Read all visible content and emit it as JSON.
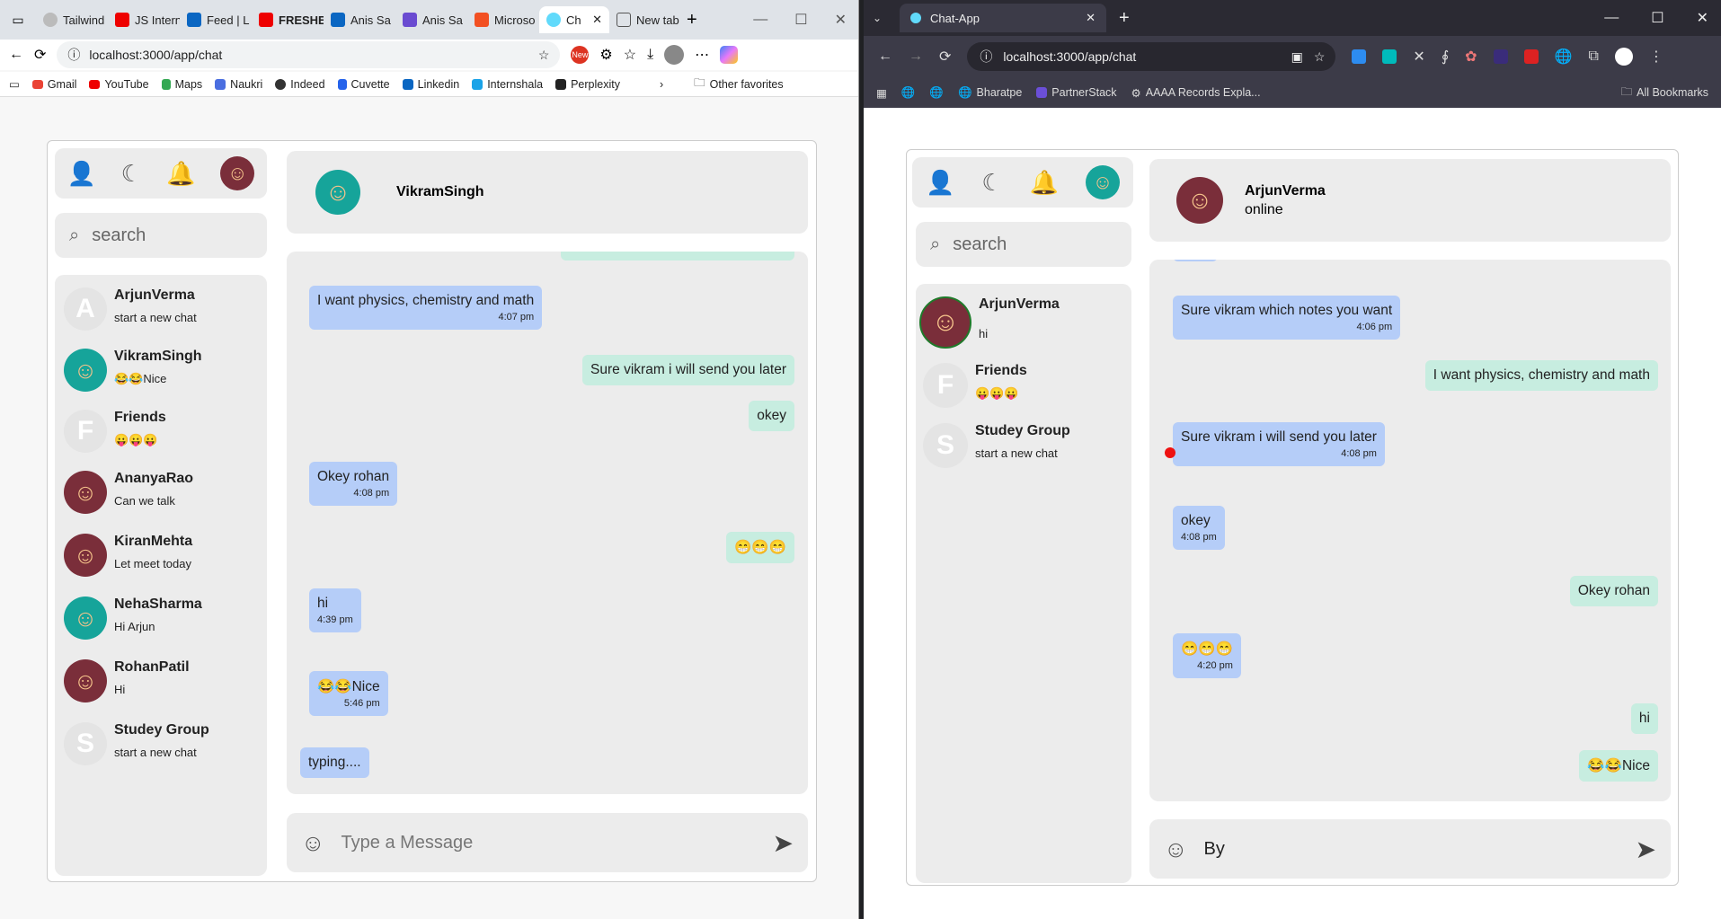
{
  "left": {
    "tabs": [
      "Tailwind",
      "JS Intern",
      "Feed | L",
      "FRESHE",
      "Anis Sa",
      "Anis Sa",
      "Microso",
      "Ch",
      "New tab"
    ],
    "url": "localhost:3000/app/chat",
    "bookmarks": [
      "Gmail",
      "YouTube",
      "Maps",
      "Naukri",
      "Indeed",
      "Cuvette",
      "Linkedin",
      "Internshala",
      "Perplexity"
    ],
    "other_favorites": "Other favorites",
    "new_badge": "New",
    "app": {
      "search_placeholder": "search",
      "header_name": "VikramSingh",
      "contacts": [
        {
          "letter": "A",
          "name": "ArjunVerma",
          "sub": "start a new chat"
        },
        {
          "name": "VikramSingh",
          "sub": "😂😂Nice"
        },
        {
          "letter": "F",
          "name": "Friends",
          "sub": "😛😛😛"
        },
        {
          "name": "AnanyaRao",
          "sub": "Can we talk"
        },
        {
          "name": "KiranMehta",
          "sub": "Let meet today"
        },
        {
          "name": "NehaSharma",
          "sub": "Hi Arjun"
        },
        {
          "name": "RohanPatil",
          "sub": "Hi"
        },
        {
          "letter": "S",
          "name": "Studey Group",
          "sub": "start a new chat"
        }
      ],
      "messages": [
        {
          "text": "I want physics, chemistry and math",
          "time": "4:07 pm"
        },
        {
          "text": "Sure vikram i will send you later"
        },
        {
          "text": "okey"
        },
        {
          "text": "Okey rohan",
          "time": "4:08 pm"
        },
        {
          "text": "😁😁😁"
        },
        {
          "text": "hi",
          "time": "4:39 pm"
        },
        {
          "text": "😂😂Nice",
          "time": "5:46 pm"
        },
        {
          "text": "typing...."
        }
      ],
      "input_placeholder": "Type a Message"
    }
  },
  "right": {
    "tab_title": "Chat-App",
    "url": "localhost:3000/app/chat",
    "bookmarks": [
      "Bharatpe",
      "PartnerStack",
      "AAAA Records Expla..."
    ],
    "all_bookmarks": "All Bookmarks",
    "app": {
      "search_placeholder": "search",
      "header_name": "ArjunVerma",
      "header_status": "online",
      "contacts": [
        {
          "name": "ArjunVerma",
          "sub": "hi"
        },
        {
          "letter": "F",
          "name": "Friends",
          "sub": "😛😛😛"
        },
        {
          "letter": "S",
          "name": "Studey Group",
          "sub": "start a new chat"
        }
      ],
      "messages": [
        {
          "text": "Sure vikram which notes you want",
          "time": "4:06 pm"
        },
        {
          "text": "I want physics, chemistry and math"
        },
        {
          "text": "Sure vikram i will send you later",
          "time": "4:08 pm"
        },
        {
          "text": "okey",
          "time": "4:08 pm"
        },
        {
          "text": "Okey rohan"
        },
        {
          "text": "😁😁😁",
          "time": "4:20 pm"
        },
        {
          "text": "hi"
        },
        {
          "text": "😂😂Nice"
        }
      ],
      "input_value": "By"
    }
  }
}
